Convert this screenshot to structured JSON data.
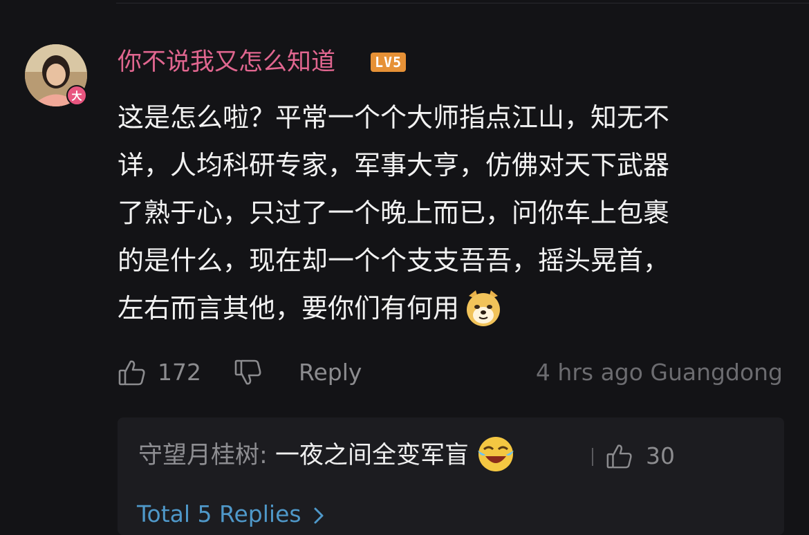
{
  "comment": {
    "username": "你不说我又怎么知道",
    "level_badge": "LV5",
    "avatar_badge": "大",
    "body_lines": [
      "这是怎么啦？平常一个个大师指点江山，知无不",
      "详，人均科研专家，军事大亨，仿佛对天下武器",
      "了熟于心，只过了一个晚上而已，问你车上包裹",
      "的是什么，现在却一个个支支吾吾，摇头晃首，",
      "左右而言其他，要你们有何用"
    ],
    "emoji_icon": "doge-icon",
    "likes": "172",
    "reply_label": "Reply",
    "meta": "4 hrs ago Guangdong"
  },
  "reply_preview": {
    "author": "守望月桂树:",
    "text": "一夜之间全变军盲",
    "emoji_icon": "laugh-cry-icon",
    "likes": "30",
    "total_replies": "Total 5 Replies"
  },
  "colors": {
    "background": "#131316",
    "username": "#e0668f",
    "level_badge": "#e69136",
    "link": "#4f98c9",
    "muted": "#8c8c8f"
  }
}
